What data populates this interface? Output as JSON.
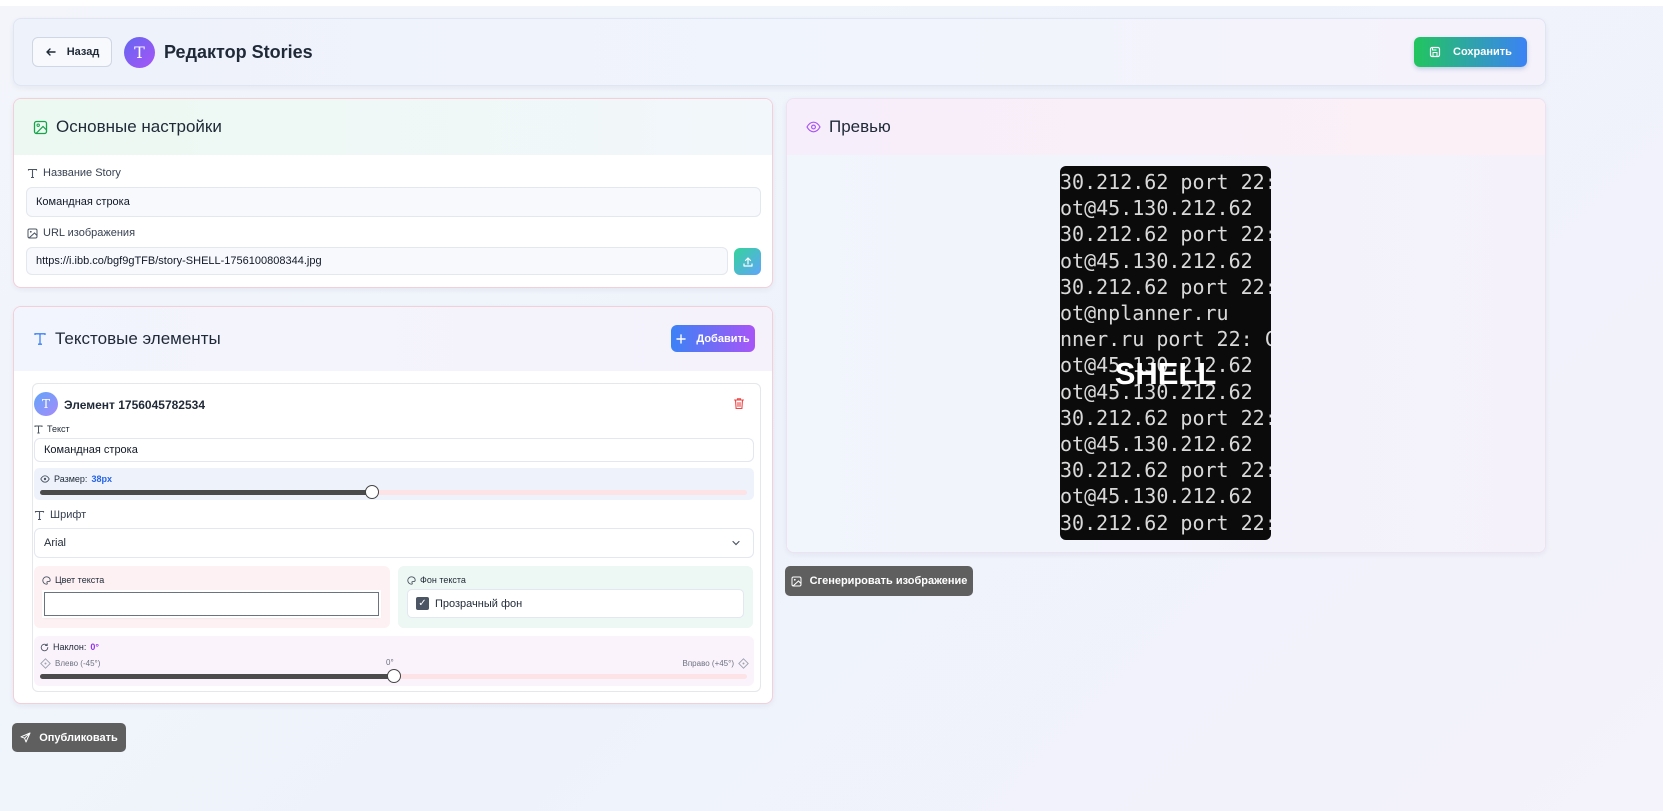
{
  "header": {
    "back_label": "Назад",
    "logo_letter": "T",
    "title": "Редактор Stories",
    "save_label": "Сохранить"
  },
  "settings": {
    "title": "Основные настройки",
    "name_label": "Название Story",
    "name_value": "Командная строка",
    "url_label": "URL изображения",
    "url_value": "https://i.ibb.co/bgf9gTFB/story-SHELL-1756100808344.jpg"
  },
  "text_elements": {
    "title": "Текстовые элементы",
    "add_label": "Добавить",
    "element": {
      "avatar_letter": "T",
      "title": "Элемент 1756045782534",
      "text_label": "Текст",
      "text_value": "Командная строка",
      "size_label": "Размер:",
      "size_value": "38px",
      "size_fraction": 0.47,
      "font_label": "Шрифт",
      "font_value": "Arial",
      "color_label": "Цвет текста",
      "color_value": "#ffffff",
      "bg_label": "Фон текста",
      "transparent_label": "Прозрачный фон",
      "transparent_checked": true,
      "tilt_label": "Наклон:",
      "tilt_value": "0°",
      "tilt_left": "Влево (-45°)",
      "tilt_center": "0°",
      "tilt_right": "Вправо (+45°)",
      "tilt_fraction": 0.5
    }
  },
  "actions": {
    "publish_label": "Опубликовать",
    "generate_label": "Сгенерировать изображение"
  },
  "preview": {
    "title": "Превью",
    "story_text": "SHELL",
    "terminal_lines": [
      "30.212.62 port 22:",
      "ot@45.130.212.62",
      "30.212.62 port 22:",
      "ot@45.130.212.62",
      "30.212.62 port 22:",
      "ot@nplanner.ru",
      "nner.ru port 22: C",
      "ot@45.130.212.62",
      "ot@45.130.212.62",
      "30.212.62 port 22:",
      "ot@45.130.212.62",
      "30.212.62 port 22:",
      "ot@45.130.212.62",
      "30.212.62 port 22:"
    ]
  },
  "colors": {
    "save_gradient": [
      "#22c55e",
      "#3b82f6"
    ],
    "add_gradient": [
      "#3b82f6",
      "#a855f7"
    ],
    "accent_blue": "#2563eb",
    "accent_purple": "#9333ea"
  }
}
